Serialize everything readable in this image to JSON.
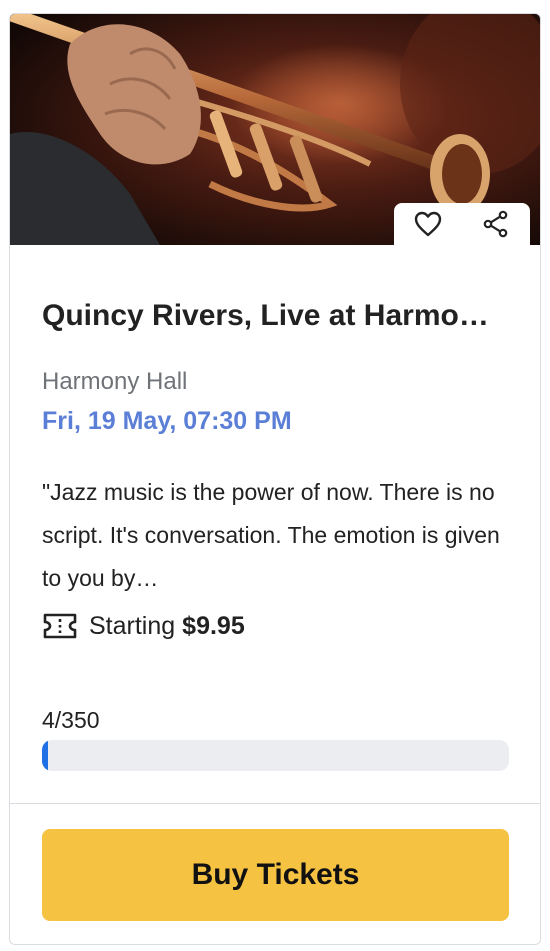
{
  "event": {
    "title": "Quincy Rivers, Live at Harmony Hall",
    "venue": "Harmony Hall",
    "datetime": "Fri, 19 May, 07:30 PM",
    "description": "\"Jazz music is the power of now. There is no script. It's conversation. The emotion is given to you by…",
    "image_subject": "trumpet player"
  },
  "price": {
    "prefix": "Starting",
    "value": "$9.95"
  },
  "tickets": {
    "count_label": "4/350",
    "sold": 4,
    "capacity": 350
  },
  "actions": {
    "favorite_icon": "heart-icon",
    "share_icon": "share-icon",
    "buy_label": "Buy Tickets"
  },
  "colors": {
    "accent": "#5b7fd6",
    "buy_button": "#f5c242",
    "progress_fill": "#1f6fe5",
    "progress_track": "#ebedf0"
  }
}
